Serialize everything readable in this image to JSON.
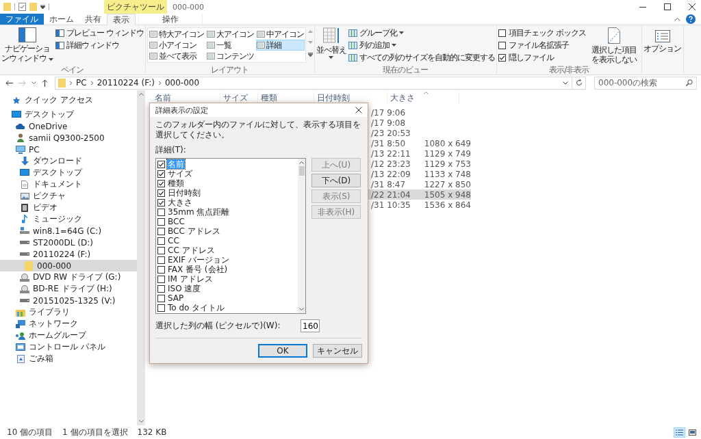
{
  "title_bar": {
    "title": "000-000",
    "contextual_group": "ピクチャツール"
  },
  "tabs": [
    {
      "label": "ファイル",
      "kind": "file",
      "selected": false
    },
    {
      "label": "ホーム",
      "kind": "normal",
      "selected": false
    },
    {
      "label": "共有",
      "kind": "normal",
      "selected": false
    },
    {
      "label": "表示",
      "kind": "normal",
      "selected": true
    },
    {
      "label": "操作",
      "kind": "contextual",
      "selected": false
    }
  ],
  "ribbon": {
    "pane": {
      "label": "ペイン",
      "nav_button": "ナビゲーションウィンドウ",
      "items": [
        "プレビュー ウィンドウ",
        "詳細ウィンドウ"
      ]
    },
    "layout": {
      "label": "レイアウト",
      "items": [
        {
          "label": "特大アイコン",
          "selected": false
        },
        {
          "label": "大アイコン",
          "selected": false
        },
        {
          "label": "中アイコン",
          "selected": false
        },
        {
          "label": "小アイコン",
          "selected": false
        },
        {
          "label": "一覧",
          "selected": false
        },
        {
          "label": "詳細",
          "selected": true
        },
        {
          "label": "並べて表示",
          "selected": false
        },
        {
          "label": "コンテンツ",
          "selected": false
        }
      ]
    },
    "current_view": {
      "label": "現在のビュー",
      "sort_button": "並べ替え",
      "items": [
        {
          "label": "グループ化",
          "dropdown": true
        },
        {
          "label": "列の追加",
          "dropdown": true
        },
        {
          "label": "すべての列のサイズを自動的に変更する",
          "dropdown": false
        }
      ]
    },
    "show_hide": {
      "label": "表示/非表示",
      "checkboxes": [
        {
          "label": "項目チェック ボックス",
          "checked": false
        },
        {
          "label": "ファイル名拡張子",
          "checked": false
        },
        {
          "label": "隠しファイル",
          "checked": true
        }
      ],
      "hide_button": "選択した項目を表示しない"
    },
    "options": {
      "label": "オプション"
    }
  },
  "address_bar": {
    "path": [
      "PC",
      "20110224 (F:)",
      "000-000"
    ],
    "search_placeholder": "000-000の検索"
  },
  "navigation_pane": {
    "items": [
      {
        "label": "クイック アクセス",
        "kind": "star",
        "selected": false
      },
      {
        "label": "デスクトップ",
        "kind": "desktop",
        "selected": false,
        "children": [
          {
            "label": "OneDrive",
            "kind": "cloud",
            "selected": false
          },
          {
            "label": "samii Q9300-2500",
            "kind": "user",
            "selected": false
          },
          {
            "label": "PC",
            "kind": "pc",
            "selected": false,
            "children": [
              {
                "label": "ダウンロード",
                "kind": "download",
                "selected": false
              },
              {
                "label": "デスクトップ",
                "kind": "desktop",
                "selected": false
              },
              {
                "label": "ドキュメント",
                "kind": "document",
                "selected": false
              },
              {
                "label": "ピクチャ",
                "kind": "picture",
                "selected": false
              },
              {
                "label": "ビデオ",
                "kind": "video",
                "selected": false
              },
              {
                "label": "ミュージック",
                "kind": "music",
                "selected": false
              },
              {
                "label": "win8.1=64G (C:)",
                "kind": "system_drive",
                "selected": false
              },
              {
                "label": "ST2000DL (D:)",
                "kind": "drive",
                "selected": false
              },
              {
                "label": "20110224 (F:)",
                "kind": "drive",
                "selected": false,
                "children": [
                  {
                    "label": "000-000",
                    "kind": "folder",
                    "selected": true
                  }
                ]
              },
              {
                "label": "DVD RW ドライブ (G:)",
                "kind": "disc",
                "selected": false
              },
              {
                "label": "BD-RE ドライブ (H:)",
                "kind": "disc",
                "selected": false
              },
              {
                "label": "20151025-1325 (V:)",
                "kind": "drive",
                "selected": false
              }
            ]
          },
          {
            "label": "ライブラリ",
            "kind": "library",
            "selected": false
          },
          {
            "label": "ネットワーク",
            "kind": "network",
            "selected": false
          },
          {
            "label": "ホームグループ",
            "kind": "homegroup",
            "selected": false
          },
          {
            "label": "コントロール パネル",
            "kind": "control",
            "selected": false
          },
          {
            "label": "ごみ箱",
            "kind": "trash",
            "selected": false
          }
        ]
      }
    ]
  },
  "file_list": {
    "columns": [
      "名前",
      "サイズ",
      "種類",
      "日付時刻",
      "大きさ"
    ],
    "rows": [
      {
        "date": "/17 9:06",
        "selected": false
      },
      {
        "date": "/17 9:08",
        "selected": false
      },
      {
        "date": "/23 20:53",
        "selected": false
      },
      {
        "date": "/31 8:50",
        "dimensions": "1080 x 649",
        "selected": false
      },
      {
        "date": "/13 22:11",
        "dimensions": "1129 x 749",
        "selected": false
      },
      {
        "date": "/12 23:23",
        "dimensions": "1129 x 753",
        "selected": false
      },
      {
        "date": "/13 22:09",
        "dimensions": "1133 x 748",
        "selected": false
      },
      {
        "date": "/31 8:47",
        "dimensions": "1227 x 850",
        "selected": false
      },
      {
        "date": "/22 21:04",
        "dimensions": "1505 x 948",
        "selected": true
      },
      {
        "date": "/31 10:35",
        "dimensions": "1536 x 864",
        "selected": false
      }
    ]
  },
  "dialog": {
    "title": "詳細表示の設定",
    "instruction": "このフォルダー内のファイルに対して、表示する項目を選択してください。",
    "list_label": "詳細(T):",
    "details": [
      {
        "label": "名前",
        "checked": true,
        "selected": true
      },
      {
        "label": "サイズ",
        "checked": true,
        "selected": false
      },
      {
        "label": "種類",
        "checked": true,
        "selected": false
      },
      {
        "label": "日付時刻",
        "checked": true,
        "selected": false
      },
      {
        "label": "大きさ",
        "checked": true,
        "selected": false
      },
      {
        "label": "35mm 焦点距離",
        "checked": false,
        "selected": false
      },
      {
        "label": "BCC",
        "checked": false,
        "selected": false
      },
      {
        "label": "BCC アドレス",
        "checked": false,
        "selected": false
      },
      {
        "label": "CC",
        "checked": false,
        "selected": false
      },
      {
        "label": "CC アドレス",
        "checked": false,
        "selected": false
      },
      {
        "label": "EXIF バージョン",
        "checked": false,
        "selected": false
      },
      {
        "label": "FAX 番号 (会社)",
        "checked": false,
        "selected": false
      },
      {
        "label": "IM アドレス",
        "checked": false,
        "selected": false
      },
      {
        "label": "ISO 速度",
        "checked": false,
        "selected": false
      },
      {
        "label": "SAP",
        "checked": false,
        "selected": false
      },
      {
        "label": "To do タイトル",
        "checked": false,
        "selected": false
      }
    ],
    "side_buttons": [
      {
        "label": "上へ(U)",
        "disabled": true
      },
      {
        "label": "下へ(D)",
        "disabled": false
      },
      {
        "label": "表示(S)",
        "disabled": true
      },
      {
        "label": "非表示(H)",
        "disabled": true
      }
    ],
    "width_label": "選択した列の幅 (ピクセルで)(W):",
    "width_value": "160",
    "buttons": [
      {
        "label": "OK",
        "default": true
      },
      {
        "label": "キャンセル",
        "default": false
      }
    ]
  },
  "status_bar": {
    "item_count": "10 個の項目",
    "selection": "1 個の項目を選択",
    "size": "132 KB",
    "views": [
      {
        "kind": "details",
        "selected": true
      },
      {
        "kind": "large_icons",
        "selected": false
      }
    ]
  }
}
